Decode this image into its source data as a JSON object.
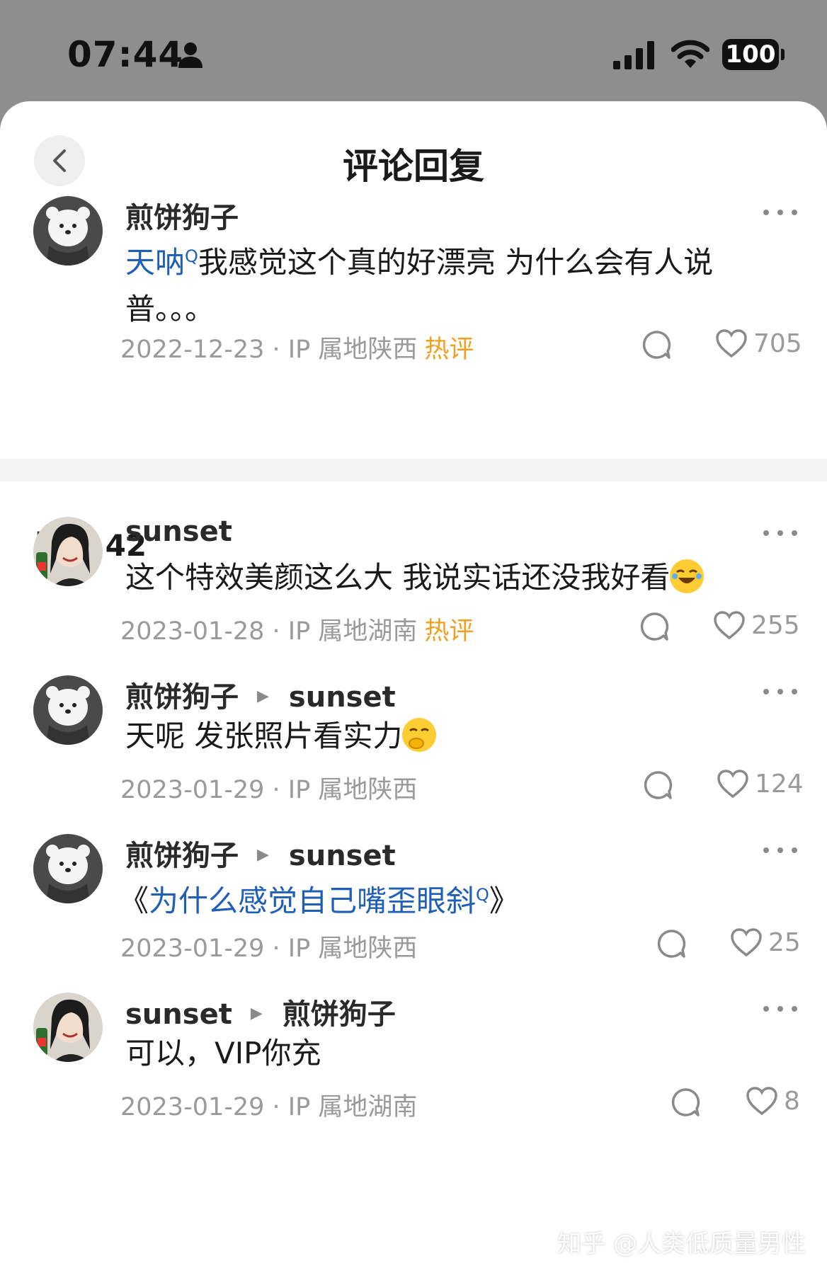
{
  "status_bar": {
    "time": "07:44",
    "battery": "100"
  },
  "header": {
    "title": "评论回复"
  },
  "main_comment": {
    "author": "煎饼狗子",
    "text_link": "天呐",
    "text": "我感觉这个真的好漂亮 为什么会有人说普。。。",
    "meta": "2022-12-23 · IP 属地陕西",
    "hot_label": "热评",
    "likes": "705"
  },
  "replies_header": "回复 42",
  "replies": [
    {
      "author": "sunset",
      "text": "这个特效美颜这么大 我说实话还没我好看",
      "meta": "2023-01-28 · IP 属地湖南",
      "hot_label": "热评",
      "likes": "255"
    },
    {
      "author": "煎饼狗子",
      "reply_to": "sunset",
      "text": "天呢 发张照片看实力",
      "meta": "2023-01-29 · IP 属地陕西",
      "likes": "124"
    },
    {
      "author": "煎饼狗子",
      "reply_to": "sunset",
      "text_prefix": "《",
      "text_link": "为什么感觉自己嘴歪眼斜",
      "text_suffix": "》",
      "meta": "2023-01-29 · IP 属地陕西",
      "likes": "25"
    },
    {
      "author": "sunset",
      "reply_to": "煎饼狗子",
      "text": "可以，VIP你充",
      "meta": "2023-01-29 · IP 属地湖南",
      "likes": "8"
    }
  ],
  "watermark": "知乎 @人类低质量男性",
  "colors": {
    "link": "#1f5fb5",
    "hot": "#f0a020",
    "meta": "#9a9a9a"
  }
}
